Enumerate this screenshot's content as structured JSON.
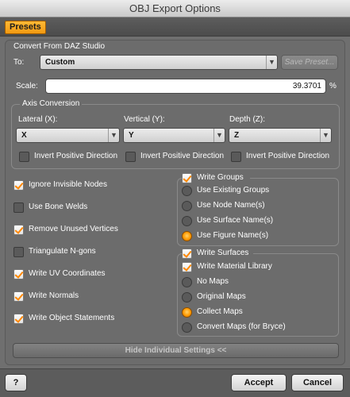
{
  "window": {
    "title": "OBJ Export Options"
  },
  "presets": {
    "tab_label": "Presets"
  },
  "convert_section": {
    "legend": "Convert From DAZ Studio",
    "to_label": "To:",
    "to_value": "Custom",
    "save_preset_label": "Save Preset...",
    "scale_label": "Scale:",
    "scale_value": "39.3701",
    "scale_unit": "%"
  },
  "axis": {
    "legend": "Axis Conversion",
    "lateral_label": "Lateral (X):",
    "lateral_value": "X",
    "vertical_label": "Vertical (Y):",
    "vertical_value": "Y",
    "depth_label": "Depth (Z):",
    "depth_value": "Z",
    "invert_label": "Invert Positive Direction",
    "invert_lateral": false,
    "invert_vertical": false,
    "invert_depth": false
  },
  "left_options": [
    {
      "label": "Ignore Invisible Nodes",
      "checked": true
    },
    {
      "label": "Use Bone Welds",
      "checked": false
    },
    {
      "label": "Remove Unused Vertices",
      "checked": true
    },
    {
      "label": "Triangulate N-gons",
      "checked": false
    },
    {
      "label": "Write UV Coordinates",
      "checked": true
    },
    {
      "label": "Write Normals",
      "checked": true
    },
    {
      "label": "Write Object Statements",
      "checked": true
    }
  ],
  "groups": {
    "header_label": "Write Groups",
    "header_checked": true,
    "options": [
      {
        "label": "Use Existing Groups",
        "selected": false
      },
      {
        "label": "Use Node Name(s)",
        "selected": false
      },
      {
        "label": "Use Surface Name(s)",
        "selected": false
      },
      {
        "label": "Use Figure Name(s)",
        "selected": true
      }
    ]
  },
  "surfaces": {
    "header_label": "Write Surfaces",
    "header_checked": true,
    "material_label": "Write Material Library",
    "material_checked": true,
    "options": [
      {
        "label": "No Maps",
        "selected": false
      },
      {
        "label": "Original Maps",
        "selected": false
      },
      {
        "label": "Collect Maps",
        "selected": true
      },
      {
        "label": "Convert Maps (for Bryce)",
        "selected": false
      }
    ]
  },
  "hide_settings_label": "Hide Individual Settings <<",
  "footer": {
    "help_label": "?",
    "accept_label": "Accept",
    "cancel_label": "Cancel"
  }
}
